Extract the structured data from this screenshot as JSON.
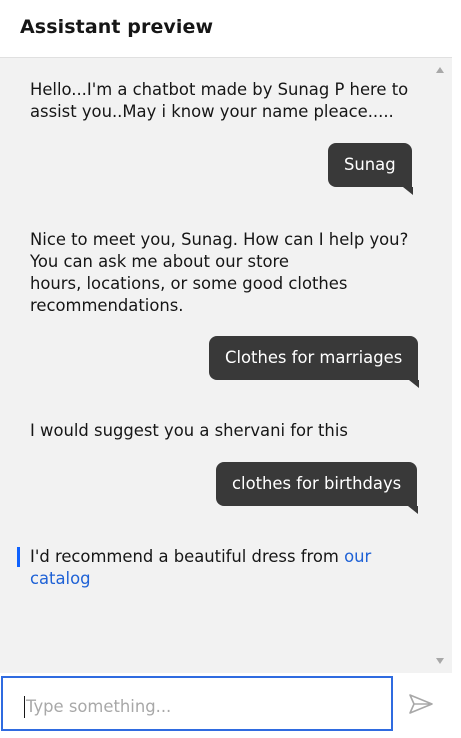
{
  "header": {
    "title": "Assistant preview"
  },
  "messages": [
    {
      "from": "bot",
      "lines": [
        "Hello...I'm a chatbot made by Sunag P here to",
        "assist you..May i know your name pleace....."
      ]
    },
    {
      "from": "user",
      "text": "Sunag"
    },
    {
      "from": "bot",
      "lines": [
        "Nice to meet you, Sunag. How can I help you?",
        "You can ask me about our store",
        "hours, locations, or some good clothes",
        "recommendations."
      ]
    },
    {
      "from": "user",
      "text": "Clothes for marriages"
    },
    {
      "from": "bot",
      "lines": [
        "I would suggest you a shervani for this"
      ]
    },
    {
      "from": "user",
      "text": "clothes for birthdays"
    },
    {
      "from": "bot",
      "text_before_link": "I'd recommend a beautiful dress from ",
      "link_text_line1": "our",
      "link_text_line2": "catalog"
    }
  ],
  "input": {
    "placeholder": "Type something...",
    "value": ""
  },
  "icons": {
    "send": "send-icon",
    "scroll_up": "scroll-up-arrow",
    "scroll_down": "scroll-down-arrow"
  },
  "colors": {
    "user_bubble": "#393939",
    "link": "#1f62d6",
    "focus": "#0f62fe",
    "background": "#f2f2f2"
  }
}
